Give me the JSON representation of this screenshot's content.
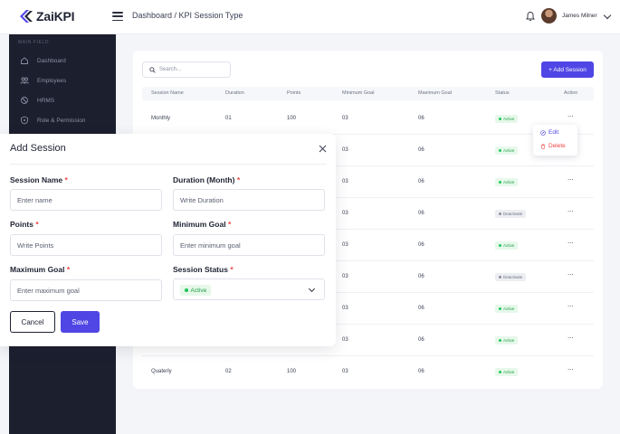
{
  "app": {
    "logo_text": "ZaiKPI"
  },
  "header": {
    "breadcrumb_root": "Dashboard",
    "breadcrumb_sep": " / ",
    "breadcrumb_current": "KPI Session Type",
    "user_name": "James Milner"
  },
  "sidebar": {
    "section_label": "MAIN FIELD",
    "items": [
      {
        "label": "Dashboard",
        "icon": "home-icon"
      },
      {
        "label": "Employees",
        "icon": "users-icon"
      },
      {
        "label": "HRMS",
        "icon": "hrms-icon"
      },
      {
        "label": "Role & Permission",
        "icon": "shield-icon"
      }
    ]
  },
  "toolbar": {
    "search_placeholder": "Search...",
    "add_label": "+ Add Session"
  },
  "table": {
    "columns": [
      "Session Name",
      "Duration",
      "Points",
      "Minimum Goal",
      "Maximum Goal",
      "Status",
      "Action"
    ],
    "rows": [
      {
        "name": "Monthly",
        "duration": "01",
        "points": "100",
        "min": "03",
        "max": "06",
        "status": "Active",
        "action": "···"
      },
      {
        "name": "",
        "duration": "",
        "points": "",
        "min": "03",
        "max": "06",
        "status": "Active",
        "action": "···"
      },
      {
        "name": "",
        "duration": "",
        "points": "",
        "min": "03",
        "max": "06",
        "status": "Active",
        "action": "···"
      },
      {
        "name": "",
        "duration": "",
        "points": "",
        "min": "03",
        "max": "06",
        "status": "Deactivate",
        "action": "···"
      },
      {
        "name": "",
        "duration": "",
        "points": "",
        "min": "03",
        "max": "06",
        "status": "Active",
        "action": "···"
      },
      {
        "name": "",
        "duration": "",
        "points": "",
        "min": "03",
        "max": "06",
        "status": "Deactivate",
        "action": "···"
      },
      {
        "name": "",
        "duration": "",
        "points": "",
        "min": "03",
        "max": "06",
        "status": "Active",
        "action": "···"
      },
      {
        "name": "",
        "duration": "",
        "points": "",
        "min": "03",
        "max": "06",
        "status": "Active",
        "action": "···"
      },
      {
        "name": "Quaterly",
        "duration": "02",
        "points": "100",
        "min": "03",
        "max": "06",
        "status": "Active",
        "action": "···"
      }
    ]
  },
  "context_menu": {
    "edit_label": "Edit",
    "delete_label": "Delete"
  },
  "modal": {
    "title": "Add Session",
    "fields": {
      "session_name": {
        "label": "Session Name",
        "placeholder": "Enter name"
      },
      "duration": {
        "label": "Duration (Month)",
        "placeholder": "Write Duration"
      },
      "points": {
        "label": "Points",
        "placeholder": "Write Points"
      },
      "min_goal": {
        "label": "Minimum Goal",
        "placeholder": "Enter minimum goal"
      },
      "max_goal": {
        "label": "Maximum Goal",
        "placeholder": "Enter maximum goal"
      },
      "status": {
        "label": "Session Status",
        "value": "Active"
      }
    },
    "required_mark": "*",
    "cancel_label": "Cancel",
    "save_label": "Save"
  },
  "colors": {
    "accent": "#4f46e5",
    "sidebar_bg": "#1c1f2e",
    "active_green": "#22c55e",
    "danger": "#ef4444"
  }
}
